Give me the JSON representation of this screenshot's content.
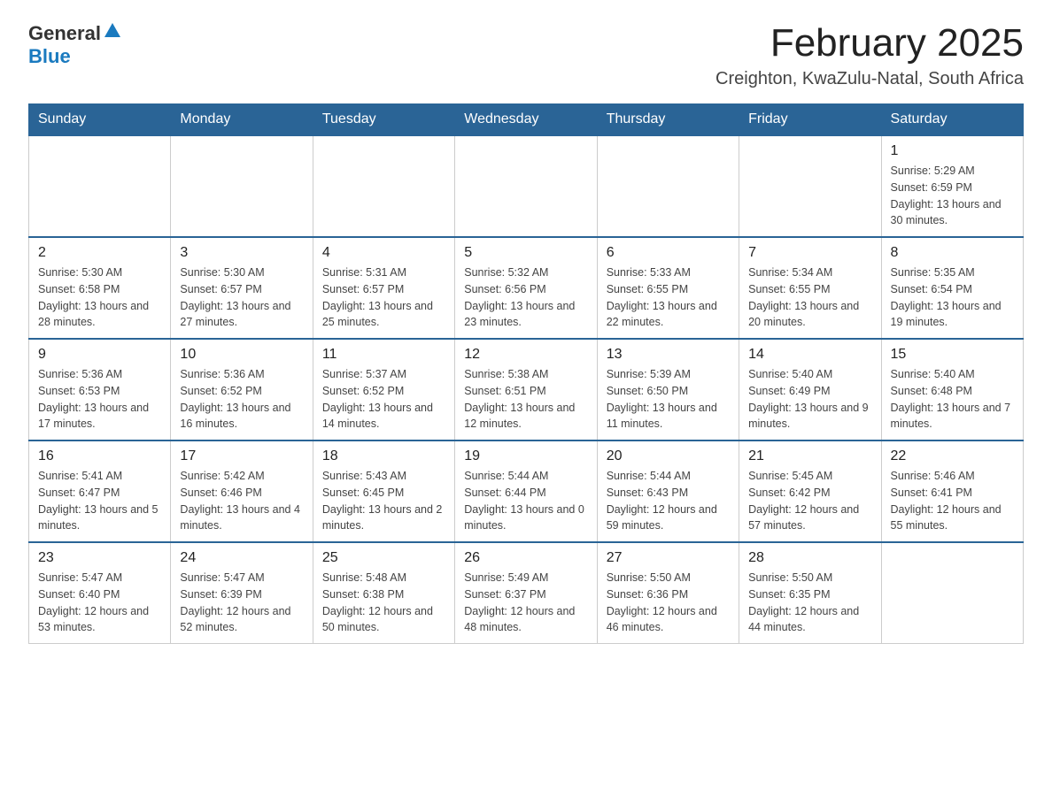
{
  "header": {
    "logo_general": "General",
    "logo_blue": "Blue",
    "title": "February 2025",
    "subtitle": "Creighton, KwaZulu-Natal, South Africa"
  },
  "days_of_week": [
    "Sunday",
    "Monday",
    "Tuesday",
    "Wednesday",
    "Thursday",
    "Friday",
    "Saturday"
  ],
  "weeks": [
    [
      {
        "day": "",
        "info": ""
      },
      {
        "day": "",
        "info": ""
      },
      {
        "day": "",
        "info": ""
      },
      {
        "day": "",
        "info": ""
      },
      {
        "day": "",
        "info": ""
      },
      {
        "day": "",
        "info": ""
      },
      {
        "day": "1",
        "info": "Sunrise: 5:29 AM\nSunset: 6:59 PM\nDaylight: 13 hours and 30 minutes."
      }
    ],
    [
      {
        "day": "2",
        "info": "Sunrise: 5:30 AM\nSunset: 6:58 PM\nDaylight: 13 hours and 28 minutes."
      },
      {
        "day": "3",
        "info": "Sunrise: 5:30 AM\nSunset: 6:57 PM\nDaylight: 13 hours and 27 minutes."
      },
      {
        "day": "4",
        "info": "Sunrise: 5:31 AM\nSunset: 6:57 PM\nDaylight: 13 hours and 25 minutes."
      },
      {
        "day": "5",
        "info": "Sunrise: 5:32 AM\nSunset: 6:56 PM\nDaylight: 13 hours and 23 minutes."
      },
      {
        "day": "6",
        "info": "Sunrise: 5:33 AM\nSunset: 6:55 PM\nDaylight: 13 hours and 22 minutes."
      },
      {
        "day": "7",
        "info": "Sunrise: 5:34 AM\nSunset: 6:55 PM\nDaylight: 13 hours and 20 minutes."
      },
      {
        "day": "8",
        "info": "Sunrise: 5:35 AM\nSunset: 6:54 PM\nDaylight: 13 hours and 19 minutes."
      }
    ],
    [
      {
        "day": "9",
        "info": "Sunrise: 5:36 AM\nSunset: 6:53 PM\nDaylight: 13 hours and 17 minutes."
      },
      {
        "day": "10",
        "info": "Sunrise: 5:36 AM\nSunset: 6:52 PM\nDaylight: 13 hours and 16 minutes."
      },
      {
        "day": "11",
        "info": "Sunrise: 5:37 AM\nSunset: 6:52 PM\nDaylight: 13 hours and 14 minutes."
      },
      {
        "day": "12",
        "info": "Sunrise: 5:38 AM\nSunset: 6:51 PM\nDaylight: 13 hours and 12 minutes."
      },
      {
        "day": "13",
        "info": "Sunrise: 5:39 AM\nSunset: 6:50 PM\nDaylight: 13 hours and 11 minutes."
      },
      {
        "day": "14",
        "info": "Sunrise: 5:40 AM\nSunset: 6:49 PM\nDaylight: 13 hours and 9 minutes."
      },
      {
        "day": "15",
        "info": "Sunrise: 5:40 AM\nSunset: 6:48 PM\nDaylight: 13 hours and 7 minutes."
      }
    ],
    [
      {
        "day": "16",
        "info": "Sunrise: 5:41 AM\nSunset: 6:47 PM\nDaylight: 13 hours and 5 minutes."
      },
      {
        "day": "17",
        "info": "Sunrise: 5:42 AM\nSunset: 6:46 PM\nDaylight: 13 hours and 4 minutes."
      },
      {
        "day": "18",
        "info": "Sunrise: 5:43 AM\nSunset: 6:45 PM\nDaylight: 13 hours and 2 minutes."
      },
      {
        "day": "19",
        "info": "Sunrise: 5:44 AM\nSunset: 6:44 PM\nDaylight: 13 hours and 0 minutes."
      },
      {
        "day": "20",
        "info": "Sunrise: 5:44 AM\nSunset: 6:43 PM\nDaylight: 12 hours and 59 minutes."
      },
      {
        "day": "21",
        "info": "Sunrise: 5:45 AM\nSunset: 6:42 PM\nDaylight: 12 hours and 57 minutes."
      },
      {
        "day": "22",
        "info": "Sunrise: 5:46 AM\nSunset: 6:41 PM\nDaylight: 12 hours and 55 minutes."
      }
    ],
    [
      {
        "day": "23",
        "info": "Sunrise: 5:47 AM\nSunset: 6:40 PM\nDaylight: 12 hours and 53 minutes."
      },
      {
        "day": "24",
        "info": "Sunrise: 5:47 AM\nSunset: 6:39 PM\nDaylight: 12 hours and 52 minutes."
      },
      {
        "day": "25",
        "info": "Sunrise: 5:48 AM\nSunset: 6:38 PM\nDaylight: 12 hours and 50 minutes."
      },
      {
        "day": "26",
        "info": "Sunrise: 5:49 AM\nSunset: 6:37 PM\nDaylight: 12 hours and 48 minutes."
      },
      {
        "day": "27",
        "info": "Sunrise: 5:50 AM\nSunset: 6:36 PM\nDaylight: 12 hours and 46 minutes."
      },
      {
        "day": "28",
        "info": "Sunrise: 5:50 AM\nSunset: 6:35 PM\nDaylight: 12 hours and 44 minutes."
      },
      {
        "day": "",
        "info": ""
      }
    ]
  ]
}
